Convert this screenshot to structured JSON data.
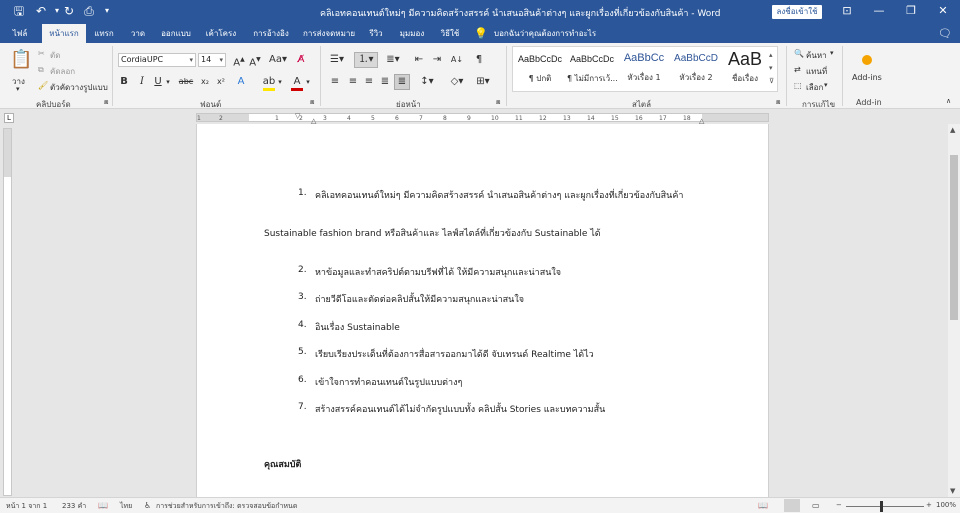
{
  "window": {
    "title": "คลิเอทคอนเทนต์ใหม่ๆ มีความคิดสร้างสรรค์ นำเสนอสินค้าต่างๆ และผูกเรื่องที่เกี่ยวข้องกับสินค้า - Word",
    "signin_label": "ลงชื่อเข้าใช้"
  },
  "quick_access": [
    "save-icon",
    "undo-icon",
    "redo-icon",
    "print-preview-icon",
    "customize-icon"
  ],
  "tabs": [
    {
      "label": "ไฟล์"
    },
    {
      "label": "หน้าแรก"
    },
    {
      "label": "แทรก"
    },
    {
      "label": "วาด"
    },
    {
      "label": "ออกแบบ"
    },
    {
      "label": "เค้าโครง"
    },
    {
      "label": "การอ้างอิง"
    },
    {
      "label": "การส่งจดหมาย"
    },
    {
      "label": "รีวิว"
    },
    {
      "label": "มุมมอง"
    },
    {
      "label": "วิธีใช้"
    }
  ],
  "tell_me": "บอกฉันว่าคุณต้องการทำอะไร",
  "ribbon": {
    "clipboard": {
      "paste": "วาง",
      "cut": "ตัด",
      "copy": "คัดลอก",
      "format_painter": "ตัวคัดวางรูปแบบ",
      "group_label": "คลิปบอร์ด"
    },
    "font": {
      "font_name": "CordiaUPC",
      "font_size": "14",
      "group_label": "ฟอนต์"
    },
    "paragraph": {
      "group_label": "ย่อหน้า"
    },
    "styles": {
      "items": [
        {
          "preview": "AaBbCcDc",
          "name": "¶ ปกติ"
        },
        {
          "preview": "AaBbCcDc",
          "name": "¶ ไม่มีการเว้..."
        },
        {
          "preview": "AaBbCc",
          "name": "หัวเรื่อง 1"
        },
        {
          "preview": "AaBbCcD",
          "name": "หัวเรื่อง 2"
        },
        {
          "preview": "AaB",
          "name": "ชื่อเรื่อง"
        }
      ],
      "group_label": "สไตล์"
    },
    "editing": {
      "find": "ค้นหา",
      "replace": "แทนที่",
      "select": "เลือก",
      "group_label": "การแก้ไข"
    },
    "addins": {
      "button": "Add-ins",
      "group_label": "Add-in"
    }
  },
  "ruler": {
    "ticks": [
      "1",
      "2",
      "1",
      "2",
      "3",
      "4",
      "5",
      "6",
      "7",
      "8",
      "9",
      "10",
      "11",
      "12",
      "13",
      "14",
      "15",
      "16",
      "17",
      "18"
    ]
  },
  "document": {
    "item1_num": "1.",
    "item1": "คลิเอทคอนเทนต์ใหม่ๆ มีความคิดสร้างสรรค์ นำเสนอสินค้าต่างๆ และผูกเรื่องที่เกี่ยวข้องกับสินค้า",
    "paragraph": "Sustainable fashion brand หรือสินค้าและ ไลฟ์สไตล์ที่เกี่ยวข้องกับ Sustainable ได้",
    "list": [
      {
        "num": "2.",
        "text": "หาข้อมูลและทำสคริปต์ตามบรีฟที่ได้ ให้มีความสนุกและน่าสนใจ"
      },
      {
        "num": "3.",
        "text": "ถ่ายวีดีโอและตัดต่อคลิปสั้นให้มีความสนุกและน่าสนใจ"
      },
      {
        "num": "4.",
        "text": "อินเรื่อง Sustainable"
      },
      {
        "num": "5.",
        "text": "เรียบเรียงประเด็นที่ต้องการสื่อสารออกมาได้ดี จับเทรนด์ Realtime ได้ไว"
      },
      {
        "num": "6.",
        "text": "เข้าใจการทำคอนเทนต์ในรูปแบบต่างๆ"
      },
      {
        "num": "7.",
        "text": "สร้างสรรค์คอนเทนต์ได้ไม่จำกัดรูปแบบทั้ง คลิปสั้น Stories และบทความสั้น"
      }
    ],
    "heading": "คุณสมบัติ"
  },
  "status": {
    "page": "หน้า 1 จาก 1",
    "words": "233 คำ",
    "language": "ไทย",
    "accessibility": "การช่วยสำหรับการเข้าถึง: ตรวจสอบข้อกำหนด",
    "zoom": "100%"
  },
  "colors": {
    "title_bar": "#2b579a",
    "ribbon_bg": "#f3f3f3",
    "canvas_bg": "#e6e6e6",
    "highlight_yellow": "#ffe600",
    "font_red": "#d00000"
  }
}
